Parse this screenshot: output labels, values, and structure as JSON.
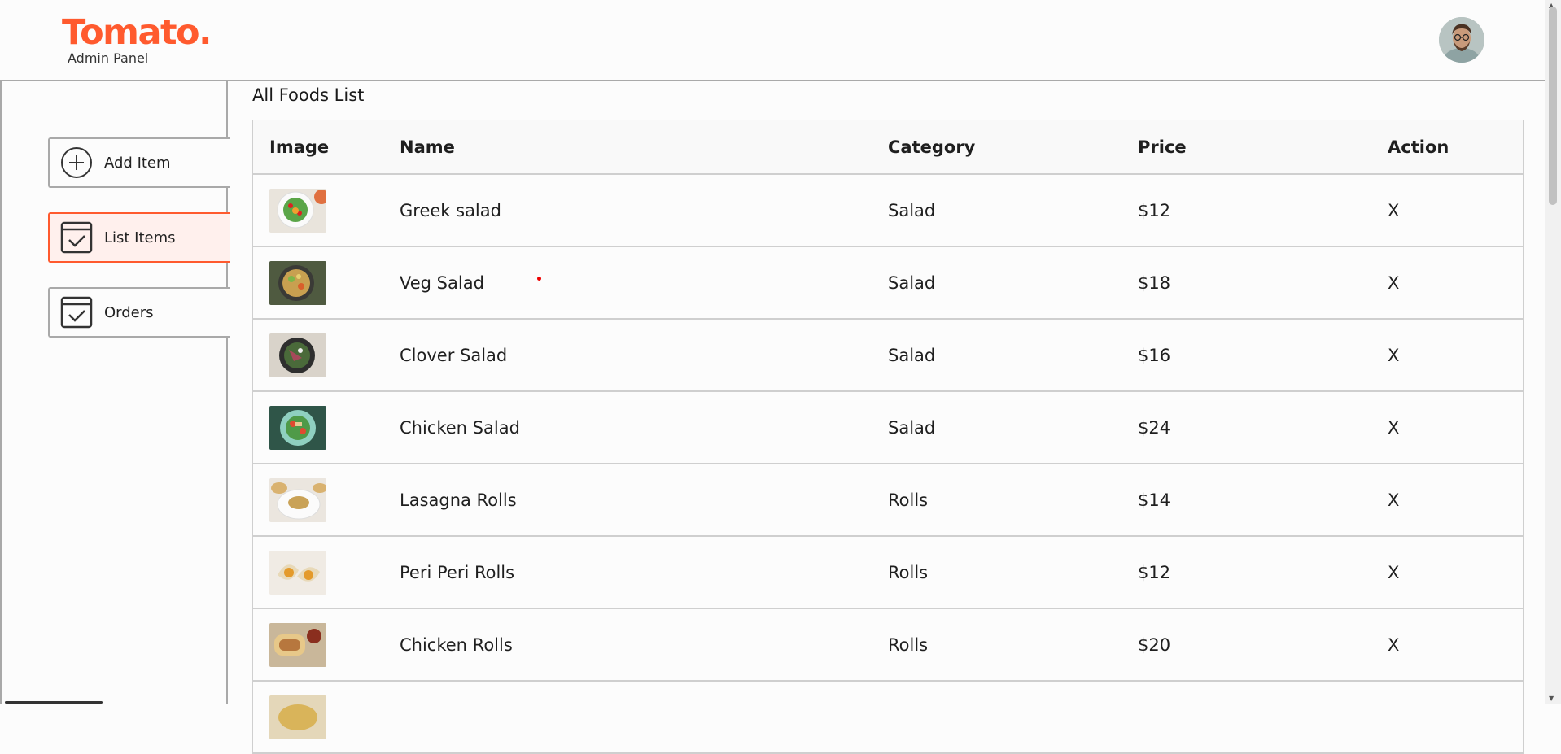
{
  "brand": {
    "name": "Tomato.",
    "subtitle": "Admin Panel",
    "color": "#ff5a2e"
  },
  "sidebar": {
    "items": [
      {
        "label": "Add Item",
        "icon": "add-circle-icon",
        "active": false
      },
      {
        "label": "List Items",
        "icon": "checklist-icon",
        "active": true
      },
      {
        "label": "Orders",
        "icon": "checklist-icon",
        "active": false
      }
    ]
  },
  "main": {
    "title": "All Foods List",
    "columns": [
      "Image",
      "Name",
      "Category",
      "Price",
      "Action"
    ],
    "rows": [
      {
        "image": "greek-salad-thumbnail",
        "name": "Greek salad",
        "category": "Salad",
        "price": "$12",
        "action": "X"
      },
      {
        "image": "veg-salad-thumbnail",
        "name": "Veg Salad",
        "category": "Salad",
        "price": "$18",
        "action": "X"
      },
      {
        "image": "clover-salad-thumbnail",
        "name": "Clover Salad",
        "category": "Salad",
        "price": "$16",
        "action": "X"
      },
      {
        "image": "chicken-salad-thumbnail",
        "name": "Chicken Salad",
        "category": "Salad",
        "price": "$24",
        "action": "X"
      },
      {
        "image": "lasagna-rolls-thumbnail",
        "name": "Lasagna Rolls",
        "category": "Rolls",
        "price": "$14",
        "action": "X"
      },
      {
        "image": "peri-peri-rolls-thumbnail",
        "name": "Peri Peri Rolls",
        "category": "Rolls",
        "price": "$12",
        "action": "X"
      },
      {
        "image": "chicken-rolls-thumbnail",
        "name": "Chicken Rolls",
        "category": "Rolls",
        "price": "$20",
        "action": "X"
      },
      {
        "image": "food-item-thumbnail",
        "name": "",
        "category": "",
        "price": "",
        "action": ""
      }
    ]
  }
}
